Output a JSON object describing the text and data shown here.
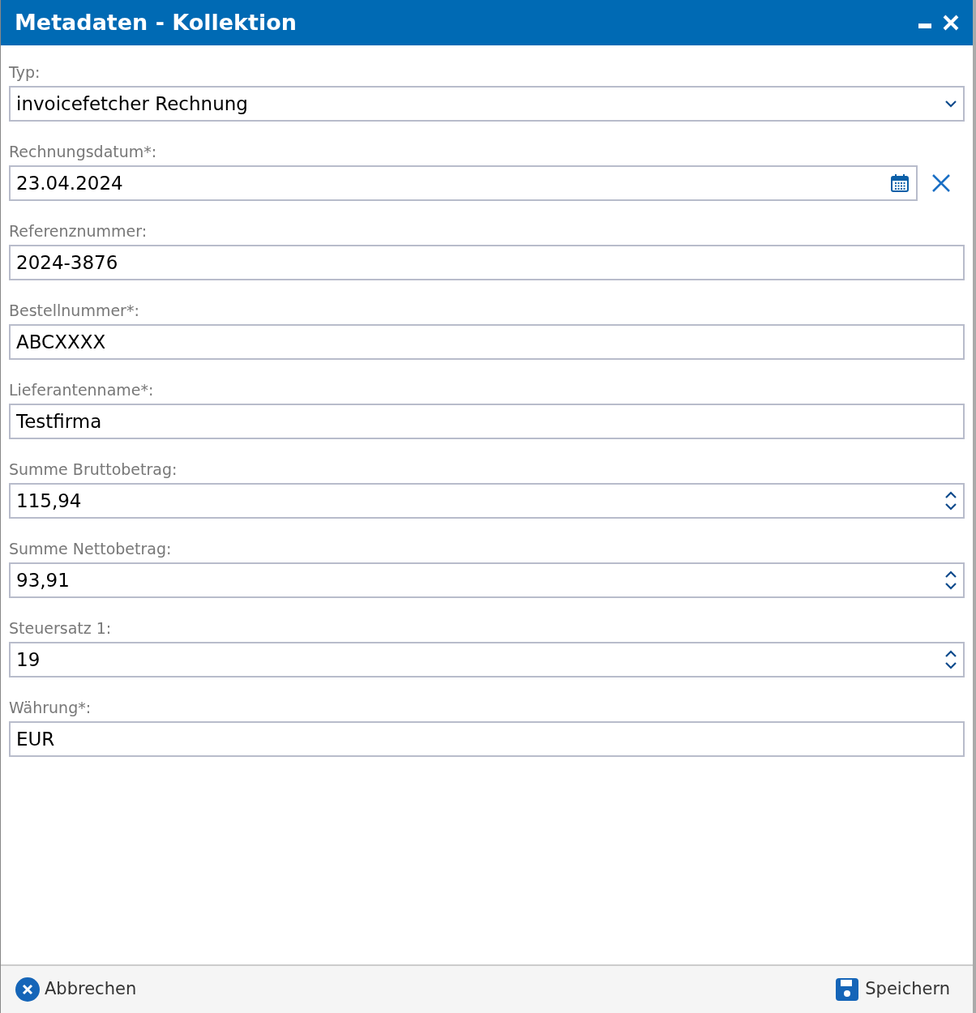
{
  "window": {
    "title": "Metadaten - Kollektion"
  },
  "fields": [
    {
      "label": "Typ:",
      "kind": "select",
      "value": "invoicefetcher Rechnung"
    },
    {
      "label": "Rechnungsdatum*:",
      "kind": "date",
      "value": "23.04.2024"
    },
    {
      "label": "Referenznummer:",
      "kind": "text",
      "value": "2024-3876"
    },
    {
      "label": "Bestellnummer*:",
      "kind": "text",
      "value": "ABCXXXX"
    },
    {
      "label": "Lieferantenname*:",
      "kind": "text",
      "value": "Testfirma"
    },
    {
      "label": "Summe Bruttobetrag:",
      "kind": "number",
      "value": "115,94"
    },
    {
      "label": "Summe Nettobetrag:",
      "kind": "number",
      "value": "93,91"
    },
    {
      "label": "Steuersatz 1:",
      "kind": "number",
      "value": "19"
    },
    {
      "label": "Währung*:",
      "kind": "text",
      "value": "EUR"
    }
  ],
  "footer": {
    "cancel": "Abbrechen",
    "save": "Speichern"
  }
}
